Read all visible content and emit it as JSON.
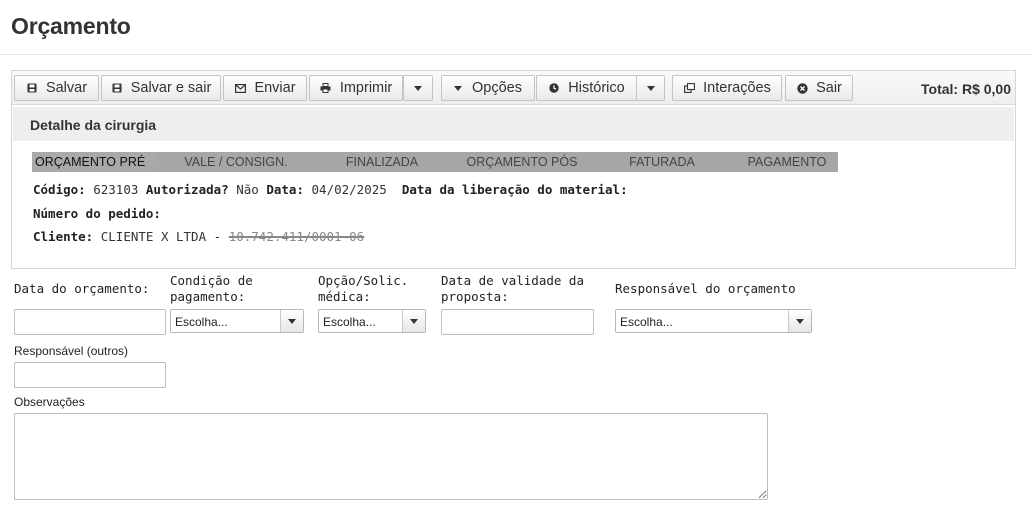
{
  "page": {
    "title": "Orçamento"
  },
  "toolbar": {
    "save": "Salvar",
    "save_exit": "Salvar e sair",
    "send": "Enviar",
    "print": "Imprimir",
    "options": "Opções",
    "history": "Histórico",
    "interactions": "Interações",
    "exit": "Sair",
    "total": "Total: R$ 0,00"
  },
  "detail": {
    "title": "Detalhe da cirurgia",
    "stages": [
      {
        "label": "ORÇAMENTO PRÉ",
        "active": true
      },
      {
        "label": "VALE / CONSIGN.",
        "active": false
      },
      {
        "label": "FINALIZADA",
        "active": false
      },
      {
        "label": "ORÇAMENTO PÓS",
        "active": false
      },
      {
        "label": "FATURADA",
        "active": false
      },
      {
        "label": "PAGAMENTO",
        "active": false
      }
    ],
    "codigo_label": "Código:",
    "codigo": "623103",
    "autorizada_label": "Autorizada?",
    "autorizada": "Não",
    "data_label": "Data:",
    "data": "04/02/2025",
    "liberacao_label": "Data da liberação do material:",
    "pedido_label": "Número do pedido:",
    "cliente_label": "Cliente:",
    "cliente": "CLIENTE X LTDA -",
    "cliente_doc": "10.742.411/0001-06"
  },
  "form": {
    "data_orcamento_label": "Data do orçamento:",
    "condicao_label": "Condição de pagamento:",
    "opcao_label": "Opção/Solic. médica:",
    "validade_label": "Data de validade da proposta:",
    "responsavel_label": "Responsável do orçamento",
    "responsavel_outros_label": "Responsável (outros)",
    "observacoes_label": "Observações",
    "select_placeholder": "Escolha..."
  },
  "colors": {
    "active_stage": "#a9a9a9",
    "inactive_stage": "#a6a6a6",
    "stage_separator": "#ffffff"
  }
}
